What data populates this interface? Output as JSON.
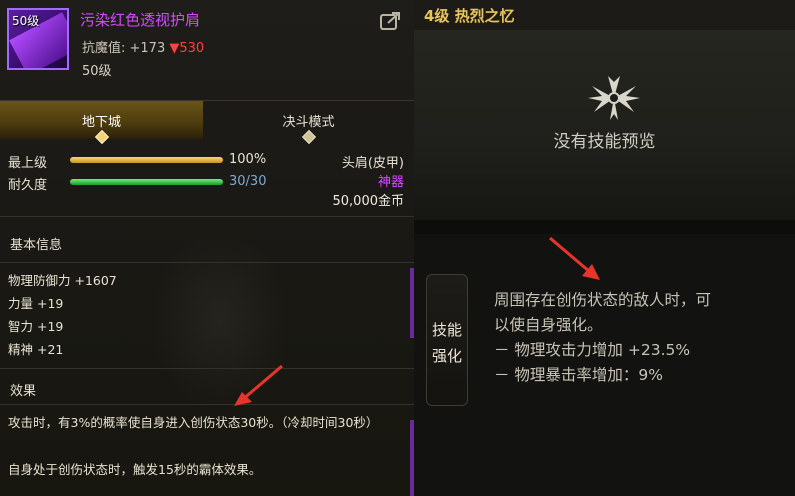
{
  "item": {
    "level_badge": "50级",
    "name": "污染红色透视护肩",
    "magic_resist_label": "抗魔值: +173",
    "magic_resist_diff": "▼530",
    "level": "50级"
  },
  "tabs": [
    {
      "label": "地下城",
      "active": true
    },
    {
      "label": "决斗模式",
      "active": false
    }
  ],
  "stats": {
    "grade": {
      "label": "最上级",
      "value": "100%",
      "fill": 1.0
    },
    "durability": {
      "label": "耐久度",
      "value": "30/30",
      "fill": 1.0
    }
  },
  "meta": {
    "slot": "头肩(皮甲)",
    "rarity": "神器",
    "price": "50,000金币"
  },
  "basic_info": {
    "title": "基本信息",
    "attributes": [
      "物理防御力 +1607",
      "力量 +19",
      "智力 +19",
      "精神 +21"
    ]
  },
  "effect": {
    "title": "效果",
    "lines": [
      "攻击时，有3%的概率使自身进入创伤状态30秒。（冷却时间30秒）",
      "自身处于创伤状态时，触发15秒的霸体效果。"
    ]
  },
  "skill_panel": {
    "title": "4级 热烈之忆",
    "no_preview": "没有技能预览",
    "badge_line1": "技能",
    "badge_line2": "强化",
    "description_lines": [
      "周围存在创伤状态的敌人时，可",
      "以使自身强化。",
      "－ 物理攻击力增加 +23.5%",
      "－ 物理暴击率增加：9%"
    ]
  },
  "colors": {
    "item_name": "#d24cff",
    "rarity": "#d24cff",
    "skill_title": "#e7c45d",
    "annotation_arrow": "#e8352b"
  }
}
